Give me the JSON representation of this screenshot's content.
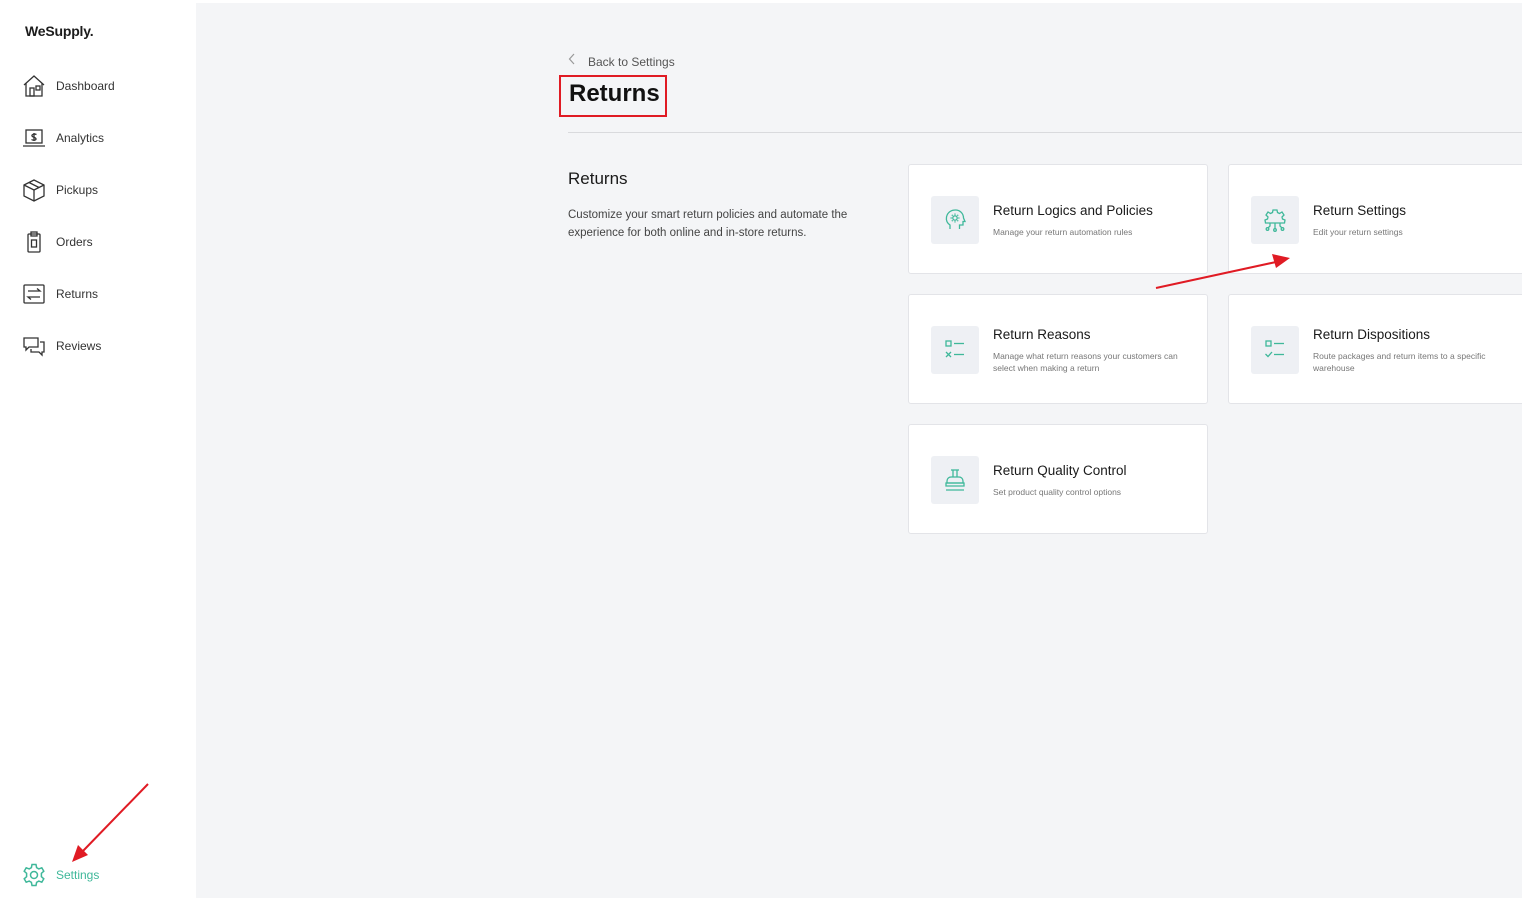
{
  "app": {
    "logo": "WeSupply."
  },
  "sidebar": {
    "items": [
      {
        "label": "Dashboard",
        "icon": "home-icon"
      },
      {
        "label": "Analytics",
        "icon": "analytics-icon"
      },
      {
        "label": "Pickups",
        "icon": "box-icon"
      },
      {
        "label": "Orders",
        "icon": "clipboard-icon"
      },
      {
        "label": "Returns",
        "icon": "returns-icon"
      },
      {
        "label": "Reviews",
        "icon": "chat-icon"
      }
    ],
    "settings": {
      "label": "Settings",
      "icon": "gear-icon"
    }
  },
  "header": {
    "back_label": "Back to Settings",
    "title": "Returns"
  },
  "section": {
    "title": "Returns",
    "description": "Customize your smart return policies and automate the experience for both online and in-store returns."
  },
  "cards": [
    {
      "title": "Return Logics and Policies",
      "description": "Manage your return automation rules",
      "icon": "head-gear-icon"
    },
    {
      "title": "Return Settings",
      "description": "Edit your return settings",
      "icon": "circuit-gear-icon"
    },
    {
      "title": "Return Reasons",
      "description": "Manage what return reasons your customers can select when making a return",
      "icon": "checklist-x-icon"
    },
    {
      "title": "Return Dispositions",
      "description": "Route packages and return items to a specific warehouse",
      "icon": "checklist-check-icon"
    },
    {
      "title": "Return Quality Control",
      "description": "Set product quality control options",
      "icon": "stamp-icon"
    }
  ],
  "colors": {
    "accent": "#3fb89a",
    "annotation": "#e01b24"
  }
}
